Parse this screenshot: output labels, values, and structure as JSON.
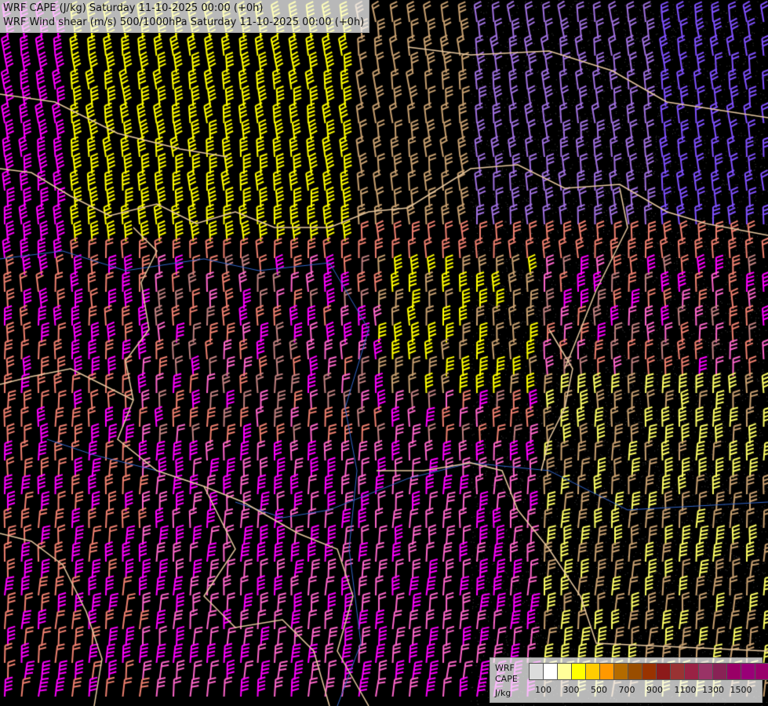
{
  "title": {
    "line1": "WRF CAPE (J/kg) Saturday 11-10-2025 00:00 (+0h)",
    "line2": "WRF Wind shear (m/s) 500/1000hPa Saturday 11-10-2025 00:00 (+0h)"
  },
  "legend": {
    "label_line1": "WRF",
    "label_line2": "CAPE",
    "unit": "J/kg",
    "colors": [
      "#dcdcdc",
      "#ffffff",
      "#ffff99",
      "#ffff00",
      "#ffcc00",
      "#ff9900",
      "#b36b00",
      "#994d00",
      "#993300",
      "#8c1a1a",
      "#993333",
      "#992244",
      "#993366",
      "#882255",
      "#990066",
      "#990077",
      "#99006b"
    ],
    "tick_labels": [
      "100",
      "300",
      "500",
      "700",
      "900",
      "1100",
      "1300",
      "1500"
    ]
  },
  "map": {
    "background_color": "#000000",
    "border_color": "#e8c9a0",
    "river_color": "#3366cc",
    "barb_colors": {
      "yellow": "#ffff00",
      "light_yellow": "#ffff66",
      "salmon": "#f08070",
      "pink": "#ff66cc",
      "magenta": "#ff00ff",
      "tan": "#c8a070",
      "mauve": "#c08080",
      "lavender": "#a070e0",
      "violet": "#8050ff",
      "peach": "#ffb070"
    }
  }
}
